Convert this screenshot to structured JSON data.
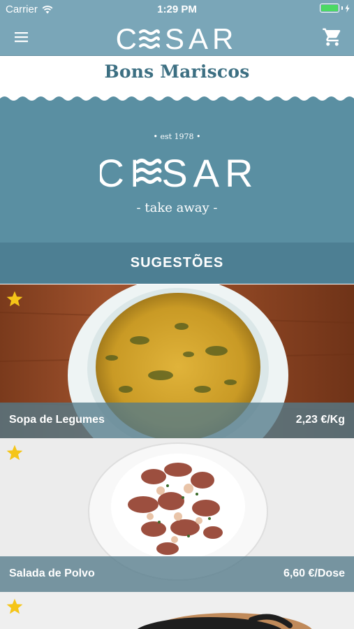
{
  "status_bar": {
    "carrier": "Carrier",
    "time": "1:29 PM"
  },
  "nav": {
    "logo_text": "CESAR",
    "menu_icon": "hamburger-menu-icon",
    "cart_icon": "shopping-cart-icon"
  },
  "banner": {
    "title": "Bons Mariscos",
    "est": "• est 1978 •",
    "logo_text": "CESAR",
    "subtitle": "- take away -"
  },
  "section": {
    "title": "SUGESTÕES"
  },
  "products": [
    {
      "name": "Sopa de Legumes",
      "price": "2,23 €/Kg",
      "featured": true
    },
    {
      "name": "Salada de Polvo",
      "price": "6,60 €/Dose",
      "featured": true
    },
    {
      "name": "",
      "price": "",
      "featured": true
    }
  ],
  "colors": {
    "header": "#7aa6b8",
    "banner": "#5a8fa2",
    "section_header": "#4d7f93",
    "star": "#f5c518",
    "battery": "#4cd964"
  }
}
